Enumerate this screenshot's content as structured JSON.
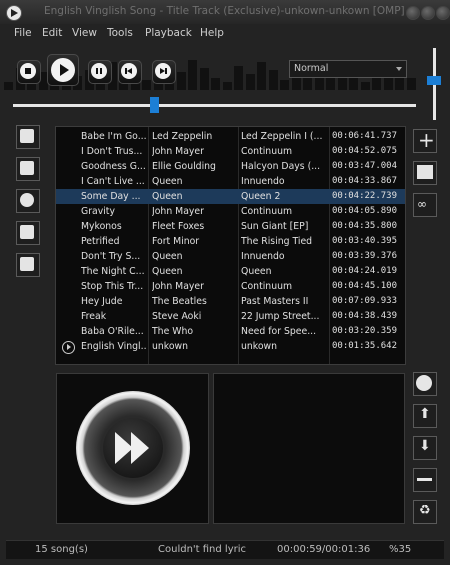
{
  "window": {
    "title": "English Vinglish Song - Title Track (Exclusive)-unkown-unkown [OMP]"
  },
  "menu": {
    "items": [
      "File",
      "Edit",
      "View",
      "Tools",
      "Playback",
      "Help"
    ]
  },
  "controls": {
    "mode_value": "Normal",
    "seek_percent": 35,
    "volume_fraction": 0.55
  },
  "playlist": {
    "selected_index": 4,
    "playing_index": 14,
    "rows": [
      {
        "title": "Babe I'm Go...",
        "artist": "Led Zeppelin",
        "album": "Led Zeppelin I (...",
        "duration": "00:06:41.737"
      },
      {
        "title": "I Don't Trus...",
        "artist": "John Mayer",
        "album": "Continuum",
        "duration": "00:04:52.075"
      },
      {
        "title": "Goodness G...",
        "artist": "Ellie Goulding",
        "album": "Halcyon Days (...",
        "duration": "00:03:47.004"
      },
      {
        "title": "I Can't Live ...",
        "artist": "Queen",
        "album": "Innuendo",
        "duration": "00:04:33.867"
      },
      {
        "title": "Some Day ...",
        "artist": "Queen",
        "album": "Queen 2",
        "duration": "00:04:22.739"
      },
      {
        "title": "Gravity",
        "artist": "John Mayer",
        "album": "Continuum",
        "duration": "00:04:05.890"
      },
      {
        "title": "Mykonos",
        "artist": "Fleet Foxes",
        "album": "Sun Giant [EP]",
        "duration": "00:04:35.800"
      },
      {
        "title": "Petrified",
        "artist": "Fort Minor",
        "album": "The Rising Tied",
        "duration": "00:03:40.395"
      },
      {
        "title": "Don't Try S...",
        "artist": "Queen",
        "album": "Innuendo",
        "duration": "00:03:39.376"
      },
      {
        "title": "The Night C...",
        "artist": "Queen",
        "album": "Queen",
        "duration": "00:04:24.019"
      },
      {
        "title": "Stop This Tr...",
        "artist": "John Mayer",
        "album": "Continuum",
        "duration": "00:04:45.100"
      },
      {
        "title": "Hey Jude",
        "artist": "The Beatles",
        "album": "Past Masters II",
        "duration": "00:07:09.933"
      },
      {
        "title": "Freak",
        "artist": "Steve Aoki",
        "album": "22 Jump Street...",
        "duration": "00:04:38.439"
      },
      {
        "title": "Baba O'Rile...",
        "artist": "The Who",
        "album": "Need for Spee...",
        "duration": "00:03:20.359"
      },
      {
        "title": "English Vingl...",
        "artist": "unkown",
        "album": "unkown",
        "duration": "00:01:35.642"
      }
    ]
  },
  "status": {
    "song_count": "15 song(s)",
    "lyric_message": "Couldn't find lyric",
    "time": "00:00:59/00:01:36",
    "percent": "%35"
  }
}
